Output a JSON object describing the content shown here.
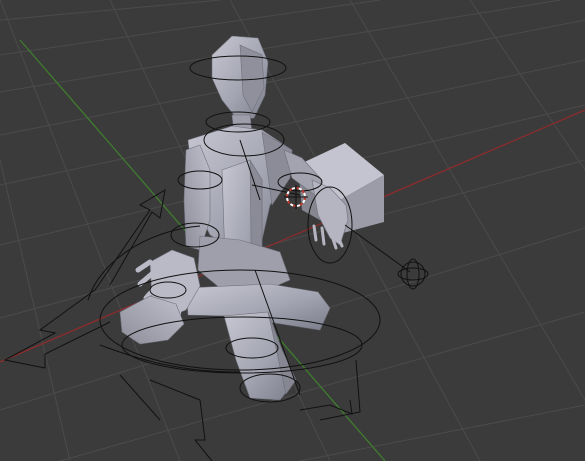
{
  "viewport": {
    "background": "#3b3b3b",
    "grid_color": "#4a4a4a",
    "x_axis_color": "#8a2c2c",
    "y_axis_color": "#3f7d2e",
    "rig_color": "#111111",
    "mesh_color": "#a7a8b4",
    "cursor_color": "#c0362c"
  },
  "scene": {
    "objects": [
      "character-mesh",
      "cube",
      "armature-rig",
      "3d-cursor"
    ]
  }
}
